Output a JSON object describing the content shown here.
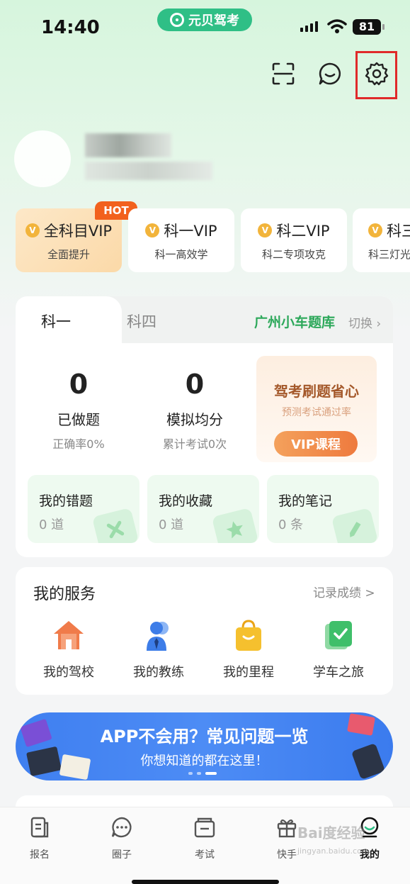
{
  "status_bar": {
    "time": "14:40",
    "battery": "81",
    "app_pill": "元贝驾考"
  },
  "vip_cards": [
    {
      "title": "全科目VIP",
      "sub": "全面提升",
      "badge": "HOT"
    },
    {
      "title": "科一VIP",
      "sub": "科一高效学"
    },
    {
      "title": "科二VIP",
      "sub": "科二专项攻克"
    },
    {
      "title": "科三",
      "sub": "科三灯光"
    }
  ],
  "subject_panel": {
    "tabs": [
      "科一",
      "科四"
    ],
    "city": "广州小车题库",
    "switch": "切换",
    "stats": [
      {
        "value": "0",
        "label": "已做题",
        "sub": "正确率0%"
      },
      {
        "value": "0",
        "label": "模拟均分",
        "sub": "累计考试0次"
      }
    ],
    "promo": {
      "title": "驾考刷题省心",
      "sub": "预测考试通过率",
      "button": "VIP课程"
    },
    "mini_cards": [
      {
        "title": "我的错题",
        "count": "0 道"
      },
      {
        "title": "我的收藏",
        "count": "0 道"
      },
      {
        "title": "我的笔记",
        "count": "0 条"
      }
    ]
  },
  "services": {
    "title": "我的服务",
    "link": "记录成绩 >",
    "items": [
      {
        "label": "我的驾校",
        "icon": "school-icon"
      },
      {
        "label": "我的教练",
        "icon": "coach-icon"
      },
      {
        "label": "我的里程",
        "icon": "mileage-icon"
      },
      {
        "label": "学车之旅",
        "icon": "journey-icon"
      }
    ]
  },
  "banner": {
    "title": "APP不会用？常见问题一览",
    "sub": "你想知道的都在这里！"
  },
  "tabbar": [
    {
      "label": "报名",
      "icon": "signup-icon"
    },
    {
      "label": "圈子",
      "icon": "chat-icon"
    },
    {
      "label": "考试",
      "icon": "exam-icon"
    },
    {
      "label": "快手",
      "icon": "gift-icon"
    },
    {
      "label": "我的",
      "icon": "profile-icon",
      "active": true
    }
  ],
  "watermark": {
    "main": "Bai度经验",
    "sub": "jingyan.baidu.com"
  },
  "colors": {
    "accent_green": "#2ca85a",
    "highlight_red": "#e02a2a",
    "hot_orange": "#f2611d",
    "banner_blue": "#4d8cf5"
  }
}
